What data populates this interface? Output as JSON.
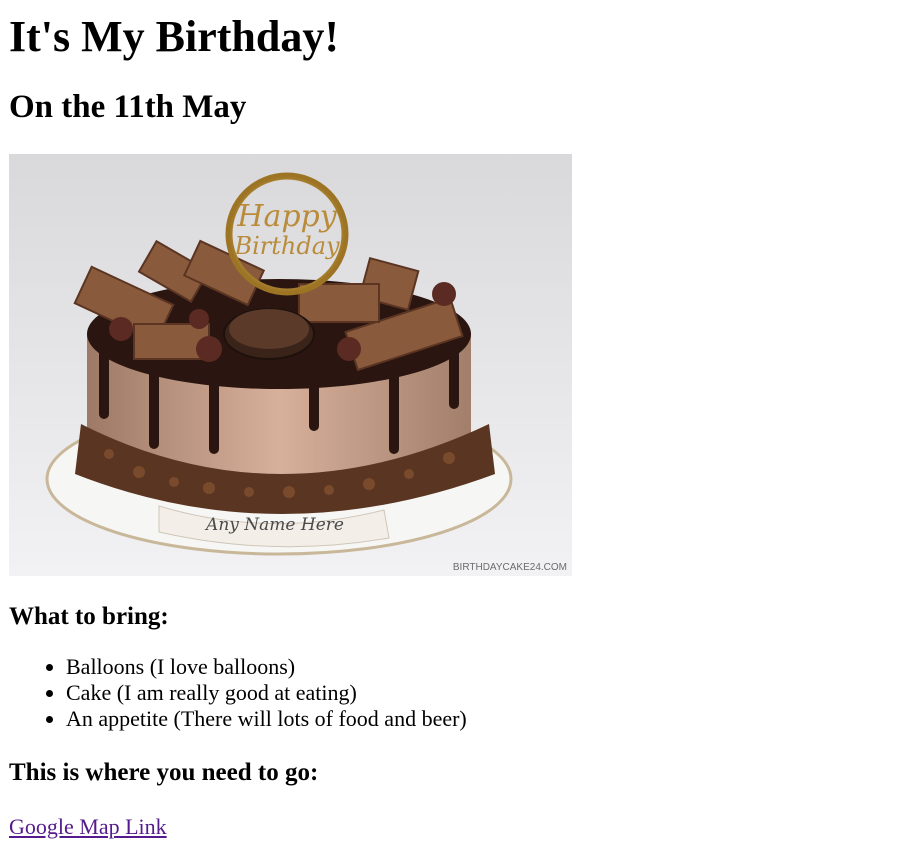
{
  "title": "It's My Birthday!",
  "date_heading": "On the 11th May",
  "image": {
    "topper_line1": "Happy",
    "topper_line2": "Birthday",
    "name_plaque": "Any Name Here",
    "watermark": "BIRTHDAYCAKE24.COM"
  },
  "bring": {
    "heading": "What to bring:",
    "items": [
      "Balloons (I love balloons)",
      "Cake (I am really good at eating)",
      "An appetite (There will lots of food and beer)"
    ]
  },
  "location": {
    "heading": "This is where you need to go:",
    "link_text": "Google Map Link"
  },
  "colors": {
    "link_visited": "#551a8b"
  }
}
